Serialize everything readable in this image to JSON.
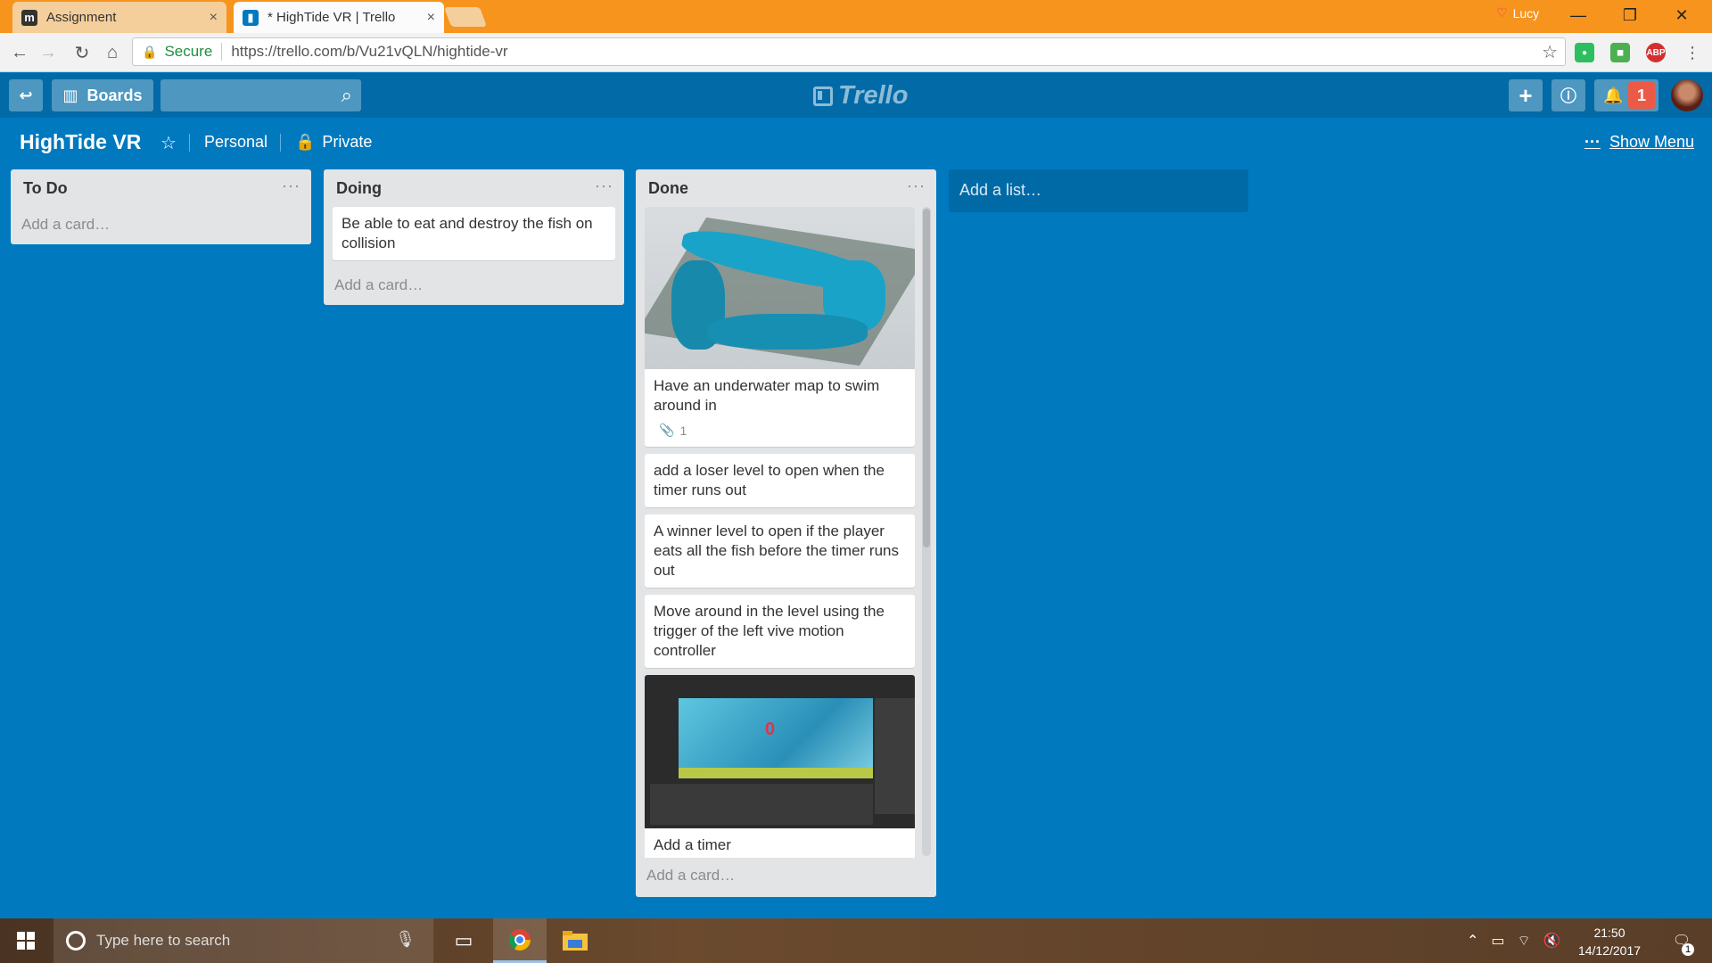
{
  "browser": {
    "tabs": [
      {
        "title": "Assignment",
        "close": "×"
      },
      {
        "title": "* HighTide VR | Trello",
        "close": "×"
      }
    ],
    "user": "Lucy",
    "address": {
      "secure_label": "Secure",
      "url": "https://trello.com/b/Vu21vQLN/hightide-vr"
    },
    "extensions": [
      {
        "name": "evernote-icon",
        "color": "#2dbe60"
      },
      {
        "name": "green-ext-icon",
        "color": "#4caf50"
      },
      {
        "name": "adblock-icon",
        "color": "#d32f2f",
        "label": "ABP"
      }
    ]
  },
  "trello_header": {
    "boards_label": "Boards",
    "logo": "Trello",
    "notifications_count": "1"
  },
  "board": {
    "title": "HighTide VR",
    "team": "Personal",
    "visibility": "Private",
    "show_menu": "Show Menu",
    "lists": [
      {
        "title": "To Do",
        "add_card": "Add a card…"
      },
      {
        "title": "Doing",
        "add_card": "Add a card…",
        "cards": [
          {
            "text": "Be able to eat and destroy the fish on collision"
          }
        ]
      },
      {
        "title": "Done",
        "add_card": "Add a card…",
        "cards": [
          {
            "text": "Have an underwater map to swim around in",
            "attachments": "1"
          },
          {
            "text": "add a loser level to open when the timer runs out"
          },
          {
            "text": "A winner level to open if the player eats all the fish before the timer runs out"
          },
          {
            "text": "Move around in the level using the trigger of the left vive motion controller"
          },
          {
            "text": "Add a timer",
            "cover_number": "0"
          }
        ]
      }
    ],
    "add_list": "Add a list…"
  },
  "taskbar": {
    "search_placeholder": "Type here to search",
    "time": "21:50",
    "date": "14/12/2017",
    "notification_count": "1"
  }
}
